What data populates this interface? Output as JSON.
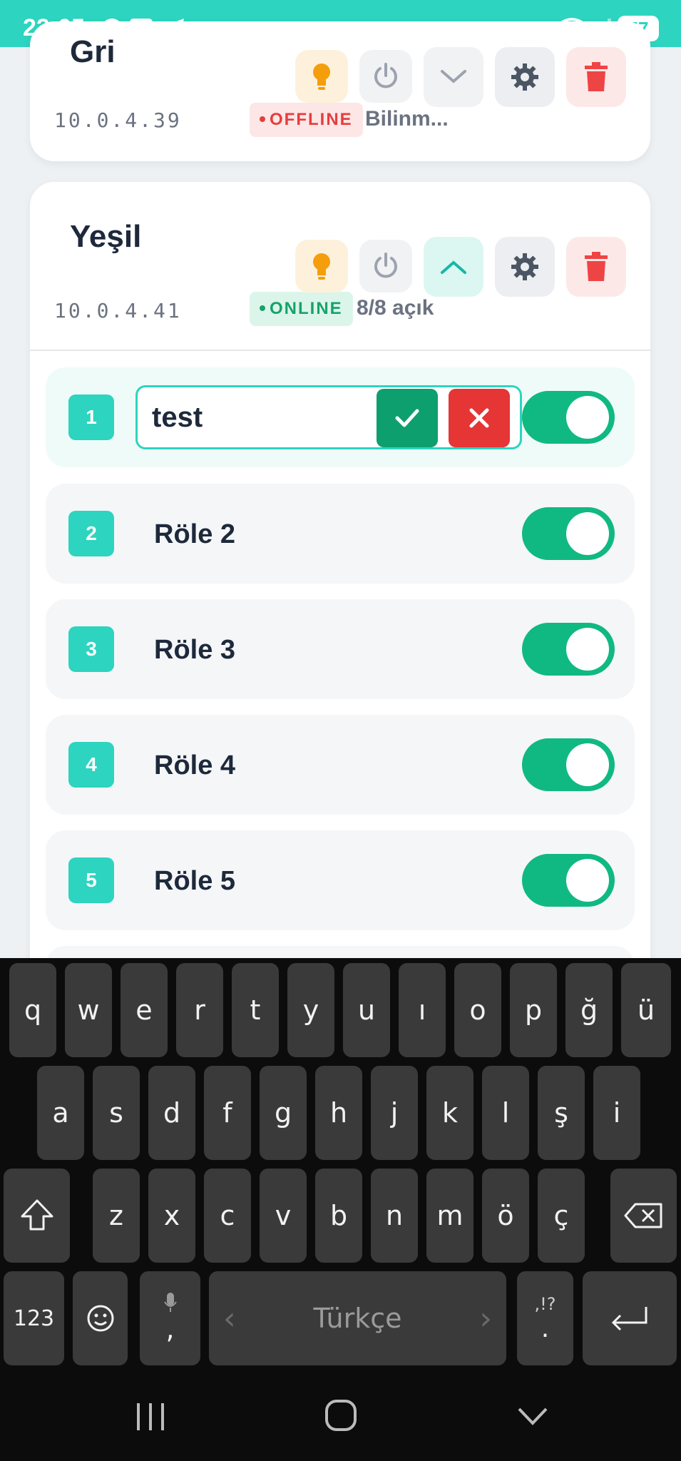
{
  "status_bar": {
    "time": "22:05",
    "notification_icons": [
      "pinterest-icon",
      "hb-icon",
      "telegram-icon",
      "dot-icon"
    ],
    "battery": "57",
    "hb_label": "hb"
  },
  "devices": [
    {
      "name": "Gri",
      "ip": "10.0.4.39",
      "status": "OFFLINE",
      "status_text": "Bilinm...",
      "expanded": false
    },
    {
      "name": "Yeşil",
      "ip": "10.0.4.41",
      "status": "ONLINE",
      "status_text": "8/8 açık",
      "expanded": true
    }
  ],
  "relays": [
    {
      "number": "1",
      "label": "test",
      "on": true,
      "editing": true
    },
    {
      "number": "2",
      "label": "Röle 2",
      "on": true
    },
    {
      "number": "3",
      "label": "Röle 3",
      "on": true
    },
    {
      "number": "4",
      "label": "Röle 4",
      "on": true
    },
    {
      "number": "5",
      "label": "Röle 5",
      "on": true
    }
  ],
  "keyboard": {
    "row1": [
      "q",
      "w",
      "e",
      "r",
      "t",
      "y",
      "u",
      "ı",
      "o",
      "p",
      "ğ",
      "ü"
    ],
    "row2": [
      "a",
      "s",
      "d",
      "f",
      "g",
      "h",
      "j",
      "k",
      "l",
      "ş",
      "i"
    ],
    "row3": [
      "z",
      "x",
      "c",
      "v",
      "b",
      "n",
      "m",
      "ö",
      "ç"
    ],
    "numbers_key": "123",
    "comma_key": ",",
    "punct_key_top": ",!?",
    "punct_key_bottom": ".",
    "space_label": "Türkçe"
  },
  "colors": {
    "accent": "#2dd4bf",
    "online": "#16a36a",
    "offline": "#e53e3e",
    "toggle_on": "#10b981"
  }
}
